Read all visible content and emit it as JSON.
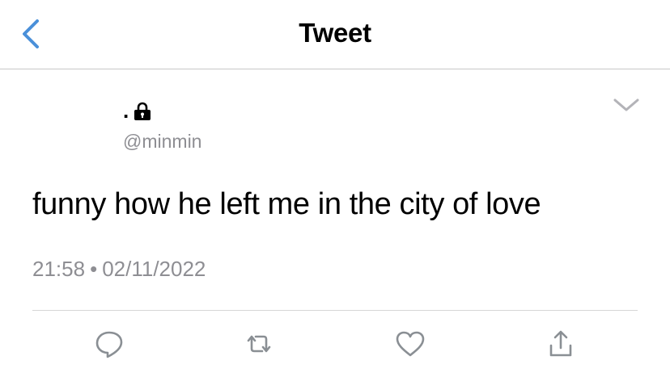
{
  "nav": {
    "title": "Tweet",
    "back_icon": "chevron-left-icon"
  },
  "tweet": {
    "display_name": ".",
    "lock_icon": "lock-icon",
    "handle": "@minmin",
    "text": "funny how he left me in the city of love",
    "time": "21:58",
    "separator": "•",
    "date": "02/11/2022",
    "menu_icon": "chevron-down-icon"
  },
  "actions": [
    {
      "icon": "reply-icon"
    },
    {
      "icon": "retweet-icon"
    },
    {
      "icon": "like-icon"
    },
    {
      "icon": "share-icon"
    }
  ],
  "colors": {
    "accent": "#4a90d9",
    "secondary_text": "#8e8e93",
    "divider": "#c8c8c8",
    "icon": "#8a8f94"
  }
}
